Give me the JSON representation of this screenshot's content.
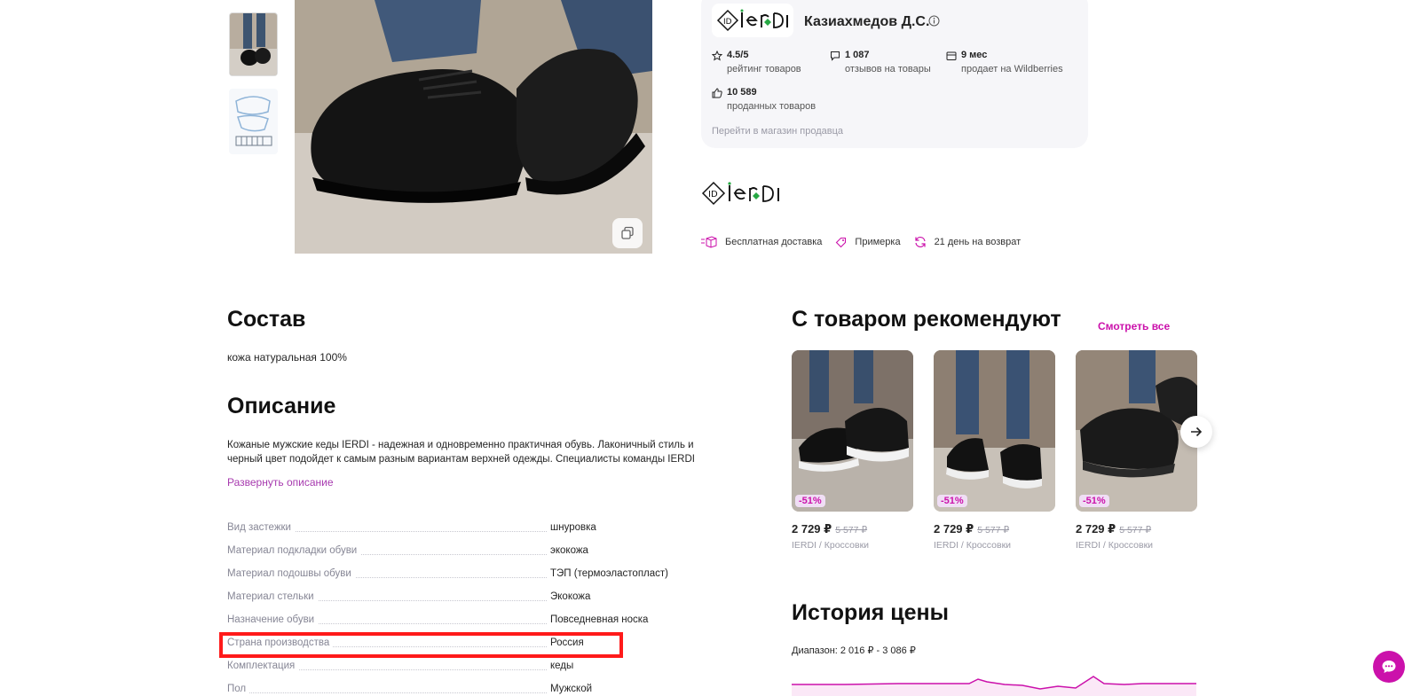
{
  "seller": {
    "name": "Казиахмедов Д.С.",
    "stats": [
      {
        "value": "4.5/5",
        "label": "рейтинг товаров",
        "icon": "star-icon"
      },
      {
        "value": "1 087",
        "label": "отзывов на товары",
        "icon": "comment-icon"
      },
      {
        "value": "9 мес",
        "label": "продает на Wildberries",
        "icon": "calendar-icon"
      },
      {
        "value": "10 589",
        "label": "проданных товаров",
        "icon": "thumbs-up-icon"
      }
    ],
    "shop_link": "Перейти в магазин продавца"
  },
  "badges": [
    "Бесплатная доставка",
    "Примерка",
    "21 день на возврат"
  ],
  "composition": {
    "title": "Состав",
    "text": "кожа натуральная 100%"
  },
  "description": {
    "title": "Описание",
    "text": "Кожаные мужские кеды IERDI - надежная и одновременно практичная обувь. Лаконичный стиль и черный цвет подойдет к самым разным вариантам верхней одежды. Специалисты команды IERDI",
    "expand_label": "Развернуть описание"
  },
  "properties": [
    {
      "key": "Вид застежки",
      "value": "шнуровка"
    },
    {
      "key": "Материал подкладки обуви",
      "value": "экокожа"
    },
    {
      "key": "Материал подошвы обуви",
      "value": "ТЭП (термоэластопласт)"
    },
    {
      "key": "Материал стельки",
      "value": "Экокожа"
    },
    {
      "key": "Назначение обуви",
      "value": "Повседневная носка"
    },
    {
      "key": "Страна производства",
      "value": "Россия"
    },
    {
      "key": "Комплектация",
      "value": "кеды"
    },
    {
      "key": "Пол",
      "value": "Мужской"
    }
  ],
  "recommendations": {
    "title": "С товаром рекомендуют",
    "see_all": "Смотреть все",
    "items": [
      {
        "discount": "-51%",
        "price": "2 729 ₽",
        "old_price": "5 577 ₽",
        "subtitle": "IERDI / Кроссовки"
      },
      {
        "discount": "-51%",
        "price": "2 729 ₽",
        "old_price": "5 577 ₽",
        "subtitle": "IERDI / Кроссовки"
      },
      {
        "discount": "-51%",
        "price": "2 729 ₽",
        "old_price": "5 577 ₽",
        "subtitle": "IERDI / Кроссовки"
      }
    ]
  },
  "price_history": {
    "title": "История цены",
    "range": "Диапазон: 2 016 ₽ - 3 086 ₽"
  },
  "colors": {
    "accent": "#cb11ab",
    "highlight": "#ff1a1a"
  }
}
